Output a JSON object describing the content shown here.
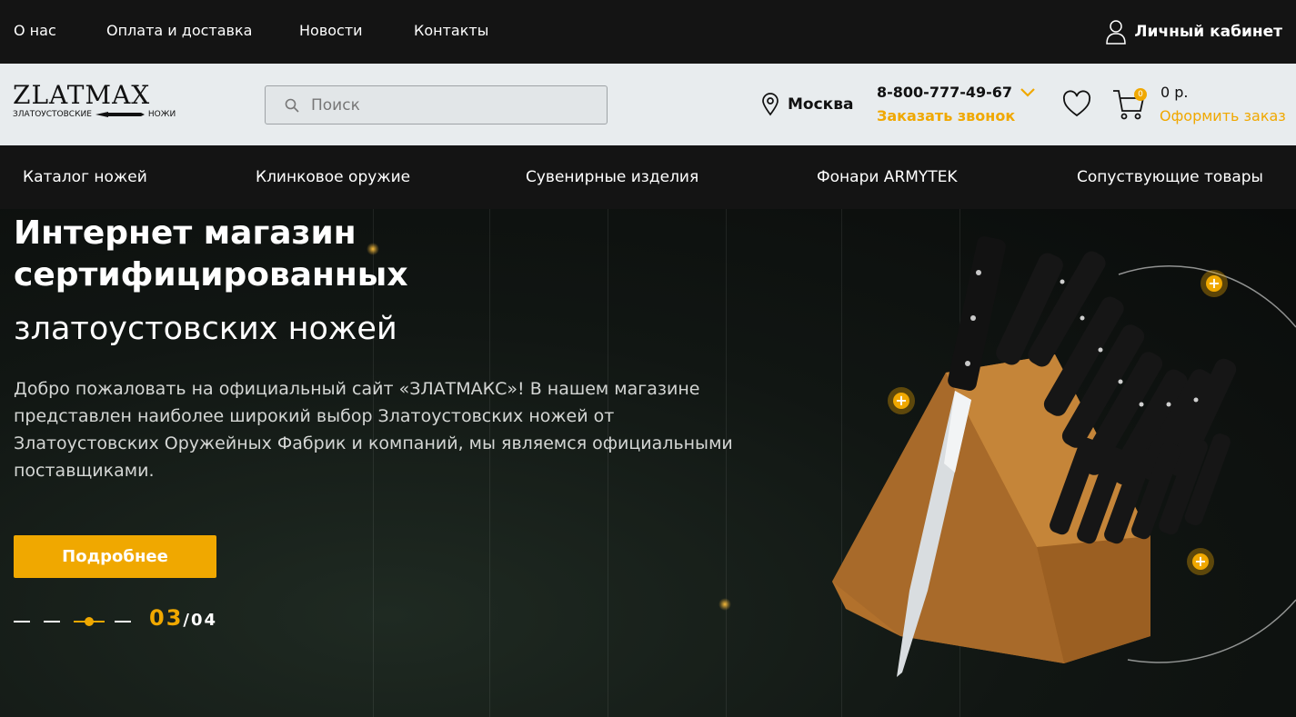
{
  "topbar": {
    "links": [
      "О нас",
      "Оплата и доставка",
      "Новости",
      "Контакты"
    ],
    "account_label": "Личный кабинет",
    "account_icon": "user-icon"
  },
  "header": {
    "logo_main": "ZLATMAX",
    "logo_sub_left": "ЗЛАТОУСТОВСКИЕ",
    "logo_sub_right": "НОЖИ",
    "search_placeholder": "Поиск",
    "search_icon": "search-icon",
    "city": "Москва",
    "city_icon": "location-pin-icon",
    "phone": "8-800-777-49-67",
    "phone_icon": "chevron-down-icon",
    "callback": "Заказать звонок",
    "favorites_icon": "heart-icon",
    "cart_icon": "cart-icon",
    "cart_count": "0",
    "cart_sum": "0 р.",
    "order_link": "Оформить заказ"
  },
  "nav": {
    "items": [
      "Каталог ножей",
      "Клинковое оружие",
      "Сувенирные изделия",
      "Фонари ARMYTEK",
      "Сопуствующие товары"
    ]
  },
  "hero": {
    "title_line1": "Интернет магазин сертифицированных",
    "title_line2": "златоустовских ножей",
    "text": "Добро пожаловать на официальный сайт «ЗЛАТМАКС»! В нашем магазине представлен наиболее широкий выбор Златоустовских ножей от Златоустовских Оружейных Фабрик и компаний, мы являемся официальными поставщиками.",
    "button": "Подробнее",
    "slide_current": "03",
    "slide_total": "/04",
    "plus_symbol": "+",
    "accent": "#f0a800"
  }
}
